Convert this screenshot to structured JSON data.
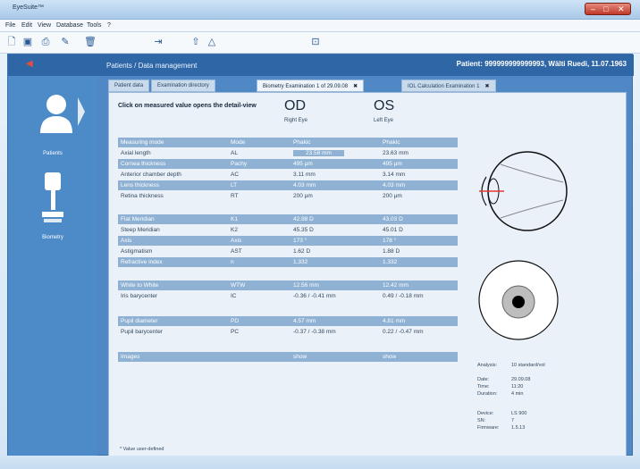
{
  "window": {
    "title": "EyeSuite™"
  },
  "menu": [
    "File",
    "Edit",
    "View",
    "Database",
    "Tools",
    "?"
  ],
  "header": {
    "crumb": "Patients / Data management",
    "patient": "Patient: 999999999999993, Wälti Ruedi, 11.07.1963"
  },
  "sidebar": {
    "patients": "Patients",
    "biometry": "Biometry"
  },
  "tabs": [
    "Patient data",
    "Examination directory",
    "Biometry Examination 1 of 29.09.08",
    "IOL Calculation Examination 1"
  ],
  "intro": "Click on measured value opens the detail-view",
  "eyes": {
    "od": "OD",
    "od_sub": "Right Eye",
    "os": "OS",
    "os_sub": "Left Eye"
  },
  "rows": [
    {
      "label": "Measuring mode",
      "abbr": "Mode",
      "od": "Phakic",
      "os": "Phakic",
      "style": "dark"
    },
    {
      "label": "Axial length",
      "abbr": "AL",
      "od": "23.58 mm",
      "os": "23.63 mm",
      "style": "odhl"
    },
    {
      "label": "Cornea thickness",
      "abbr": "Pachy",
      "od": "495 µm",
      "os": "495 µm",
      "style": "dark"
    },
    {
      "label": "Anterior chamber depth",
      "abbr": "AC",
      "od": "3.11 mm",
      "os": "3.14 mm",
      "style": ""
    },
    {
      "label": "Lens thickness",
      "abbr": "LT",
      "od": "4.03 mm",
      "os": "4.03 mm",
      "style": "dark"
    },
    {
      "label": "Retina thickness",
      "abbr": "RT",
      "od": "200 µm",
      "os": "200 µm",
      "style": ""
    },
    {
      "label": "Flat Meridian",
      "abbr": "K1",
      "od": "42.98 D",
      "os": "43.03 D",
      "style": "dark"
    },
    {
      "label": "Steep Meridian",
      "abbr": "K2",
      "od": "45.35 D",
      "os": "45.01 D",
      "style": ""
    },
    {
      "label": "Axis",
      "abbr": "Axis",
      "od": "173 °",
      "os": "178 °",
      "style": "dark"
    },
    {
      "label": "Astigmatism",
      "abbr": "AST",
      "od": "1.62 D",
      "os": "1.88 D",
      "style": ""
    },
    {
      "label": "Refractive index",
      "abbr": "n",
      "od": "1.332",
      "os": "1.332",
      "style": "dark"
    },
    {
      "label": "White to White",
      "abbr": "WTW",
      "od": "12.56 mm",
      "os": "12.42 mm",
      "style": "dark"
    },
    {
      "label": "Iris barycenter",
      "abbr": "IC",
      "od": "-0.36 / -0.41 mm",
      "os": "0.49 / -0.18 mm",
      "style": ""
    },
    {
      "label": "Pupil diameter",
      "abbr": "PD",
      "od": "4.57 mm",
      "os": "4.81 mm",
      "style": "dark"
    },
    {
      "label": "Pupil barycenter",
      "abbr": "PC",
      "od": "-0.37 / -0.38 mm",
      "os": "0.22 / -0.47 mm",
      "style": ""
    },
    {
      "label": "Images",
      "abbr": "",
      "od": "show",
      "os": "show",
      "style": "dark"
    }
  ],
  "footnote": "* Value user-defined",
  "analysis": {
    "label": "Analysis:",
    "value": "10 standard/vol"
  },
  "meta": [
    {
      "k": "Date:",
      "v": "29.09.08"
    },
    {
      "k": "Time:",
      "v": "11:20"
    },
    {
      "k": "Duration:",
      "v": "4 min"
    }
  ],
  "device": [
    {
      "k": "Device:",
      "v": "LS 900"
    },
    {
      "k": "SN:",
      "v": "7"
    },
    {
      "k": "Firmware:",
      "v": "1.5.13"
    }
  ]
}
